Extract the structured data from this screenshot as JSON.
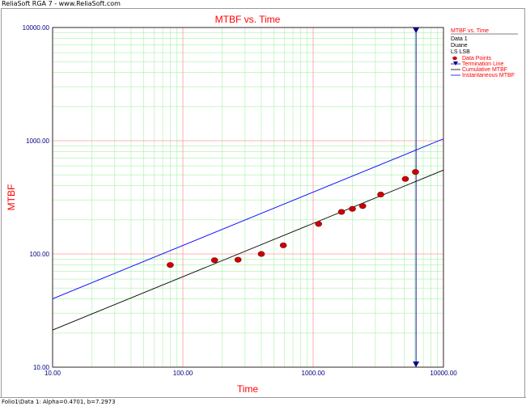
{
  "app": {
    "window_title": "ReliaSoft RGA 7 - www.ReliaSoft.com"
  },
  "status_bar": {
    "text": "Folio1\\Data 1: Alpha=0.4701, b=7.2973"
  },
  "colors": {
    "title": "#ff0000",
    "axis_label": "#ff0000",
    "tick_label": "#00007f",
    "cumulative": "#000000",
    "instantaneous": "#0000ff",
    "termination": "#00008b",
    "points": "#cc0000",
    "grid_major": "#ff9a9a",
    "grid_minor": "#a8f0a8"
  },
  "chart_data": {
    "type": "scatter",
    "title": "MTBF vs. Time",
    "xlabel": "Time",
    "ylabel": "MTBF",
    "xscale": "log",
    "yscale": "log",
    "xlim": [
      10,
      10000
    ],
    "ylim": [
      10,
      10000
    ],
    "x_tick_labels": [
      "10.00",
      "100.00",
      "1000.00",
      "10000.00"
    ],
    "y_tick_labels": [
      "10.00",
      "100.00",
      "1000.00",
      "10000.00"
    ],
    "x_ticks": [
      10,
      100,
      1000,
      10000
    ],
    "y_ticks": [
      10,
      100,
      1000,
      10000
    ],
    "grid": true,
    "legend": {
      "placement": "top-right",
      "title": "MTBF vs. Time",
      "info_lines": [
        "Data 1",
        "Duane",
        "LS LSB"
      ],
      "entries": [
        "Data Points",
        "Termination Line",
        "Cumulative MTBF",
        "Instantaneous MTBF"
      ]
    },
    "data_points": {
      "name": "Data Points",
      "x": [
        80,
        175,
        265,
        400,
        590,
        1100,
        1650,
        2000,
        2400,
        3300,
        5100,
        6100
      ],
      "y": [
        80,
        88,
        89,
        100,
        119,
        184,
        235,
        250,
        265,
        335,
        460,
        530
      ]
    },
    "cumulative_mtbf": {
      "name": "Cumulative MTBF",
      "x": [
        10,
        10000
      ],
      "y": [
        21.3,
        550
      ]
    },
    "instantaneous_mtbf": {
      "name": "Instantaneous MTBF",
      "x": [
        10,
        10000
      ],
      "y": [
        40.2,
        1040
      ]
    },
    "termination_line": {
      "name": "Termination Line",
      "x": 6160
    }
  }
}
